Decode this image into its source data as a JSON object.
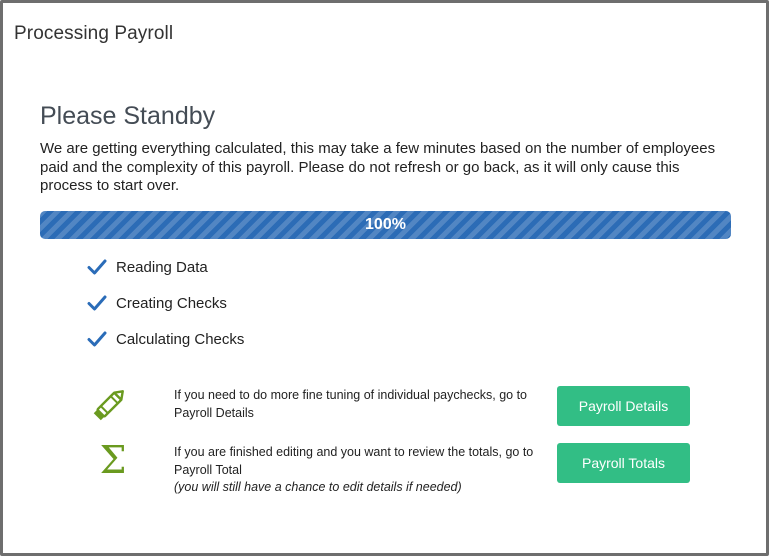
{
  "window": {
    "title": "Processing Payroll"
  },
  "status": {
    "heading": "Please Standby",
    "description": "We are getting everything calculated, this may take a few minutes based on the number of employees paid and the complexity of this payroll. Please do not refresh or go back, as it will only cause this process to start over."
  },
  "progress": {
    "percent": 100,
    "label": "100%"
  },
  "colors": {
    "progress_bar": "#2c6cb6",
    "check": "#2a6cb8",
    "action_button": "#32be85",
    "icon_green": "#6a9a1f"
  },
  "steps": [
    {
      "label": "Reading Data",
      "icon": "check-icon"
    },
    {
      "label": "Creating Checks",
      "icon": "check-icon"
    },
    {
      "label": "Calculating Checks",
      "icon": "check-icon"
    }
  ],
  "actions": [
    {
      "icon": "pencil-icon",
      "text": "If you need to do more fine tuning of individual paychecks, go to Payroll Details",
      "note": "",
      "button_label": "Payroll Details"
    },
    {
      "icon": "sigma-icon",
      "text": "If you are finished editing and you want to review the totals, go to Payroll Total",
      "note": "(you will still have a chance to edit details if needed)",
      "button_label": "Payroll Totals"
    }
  ]
}
